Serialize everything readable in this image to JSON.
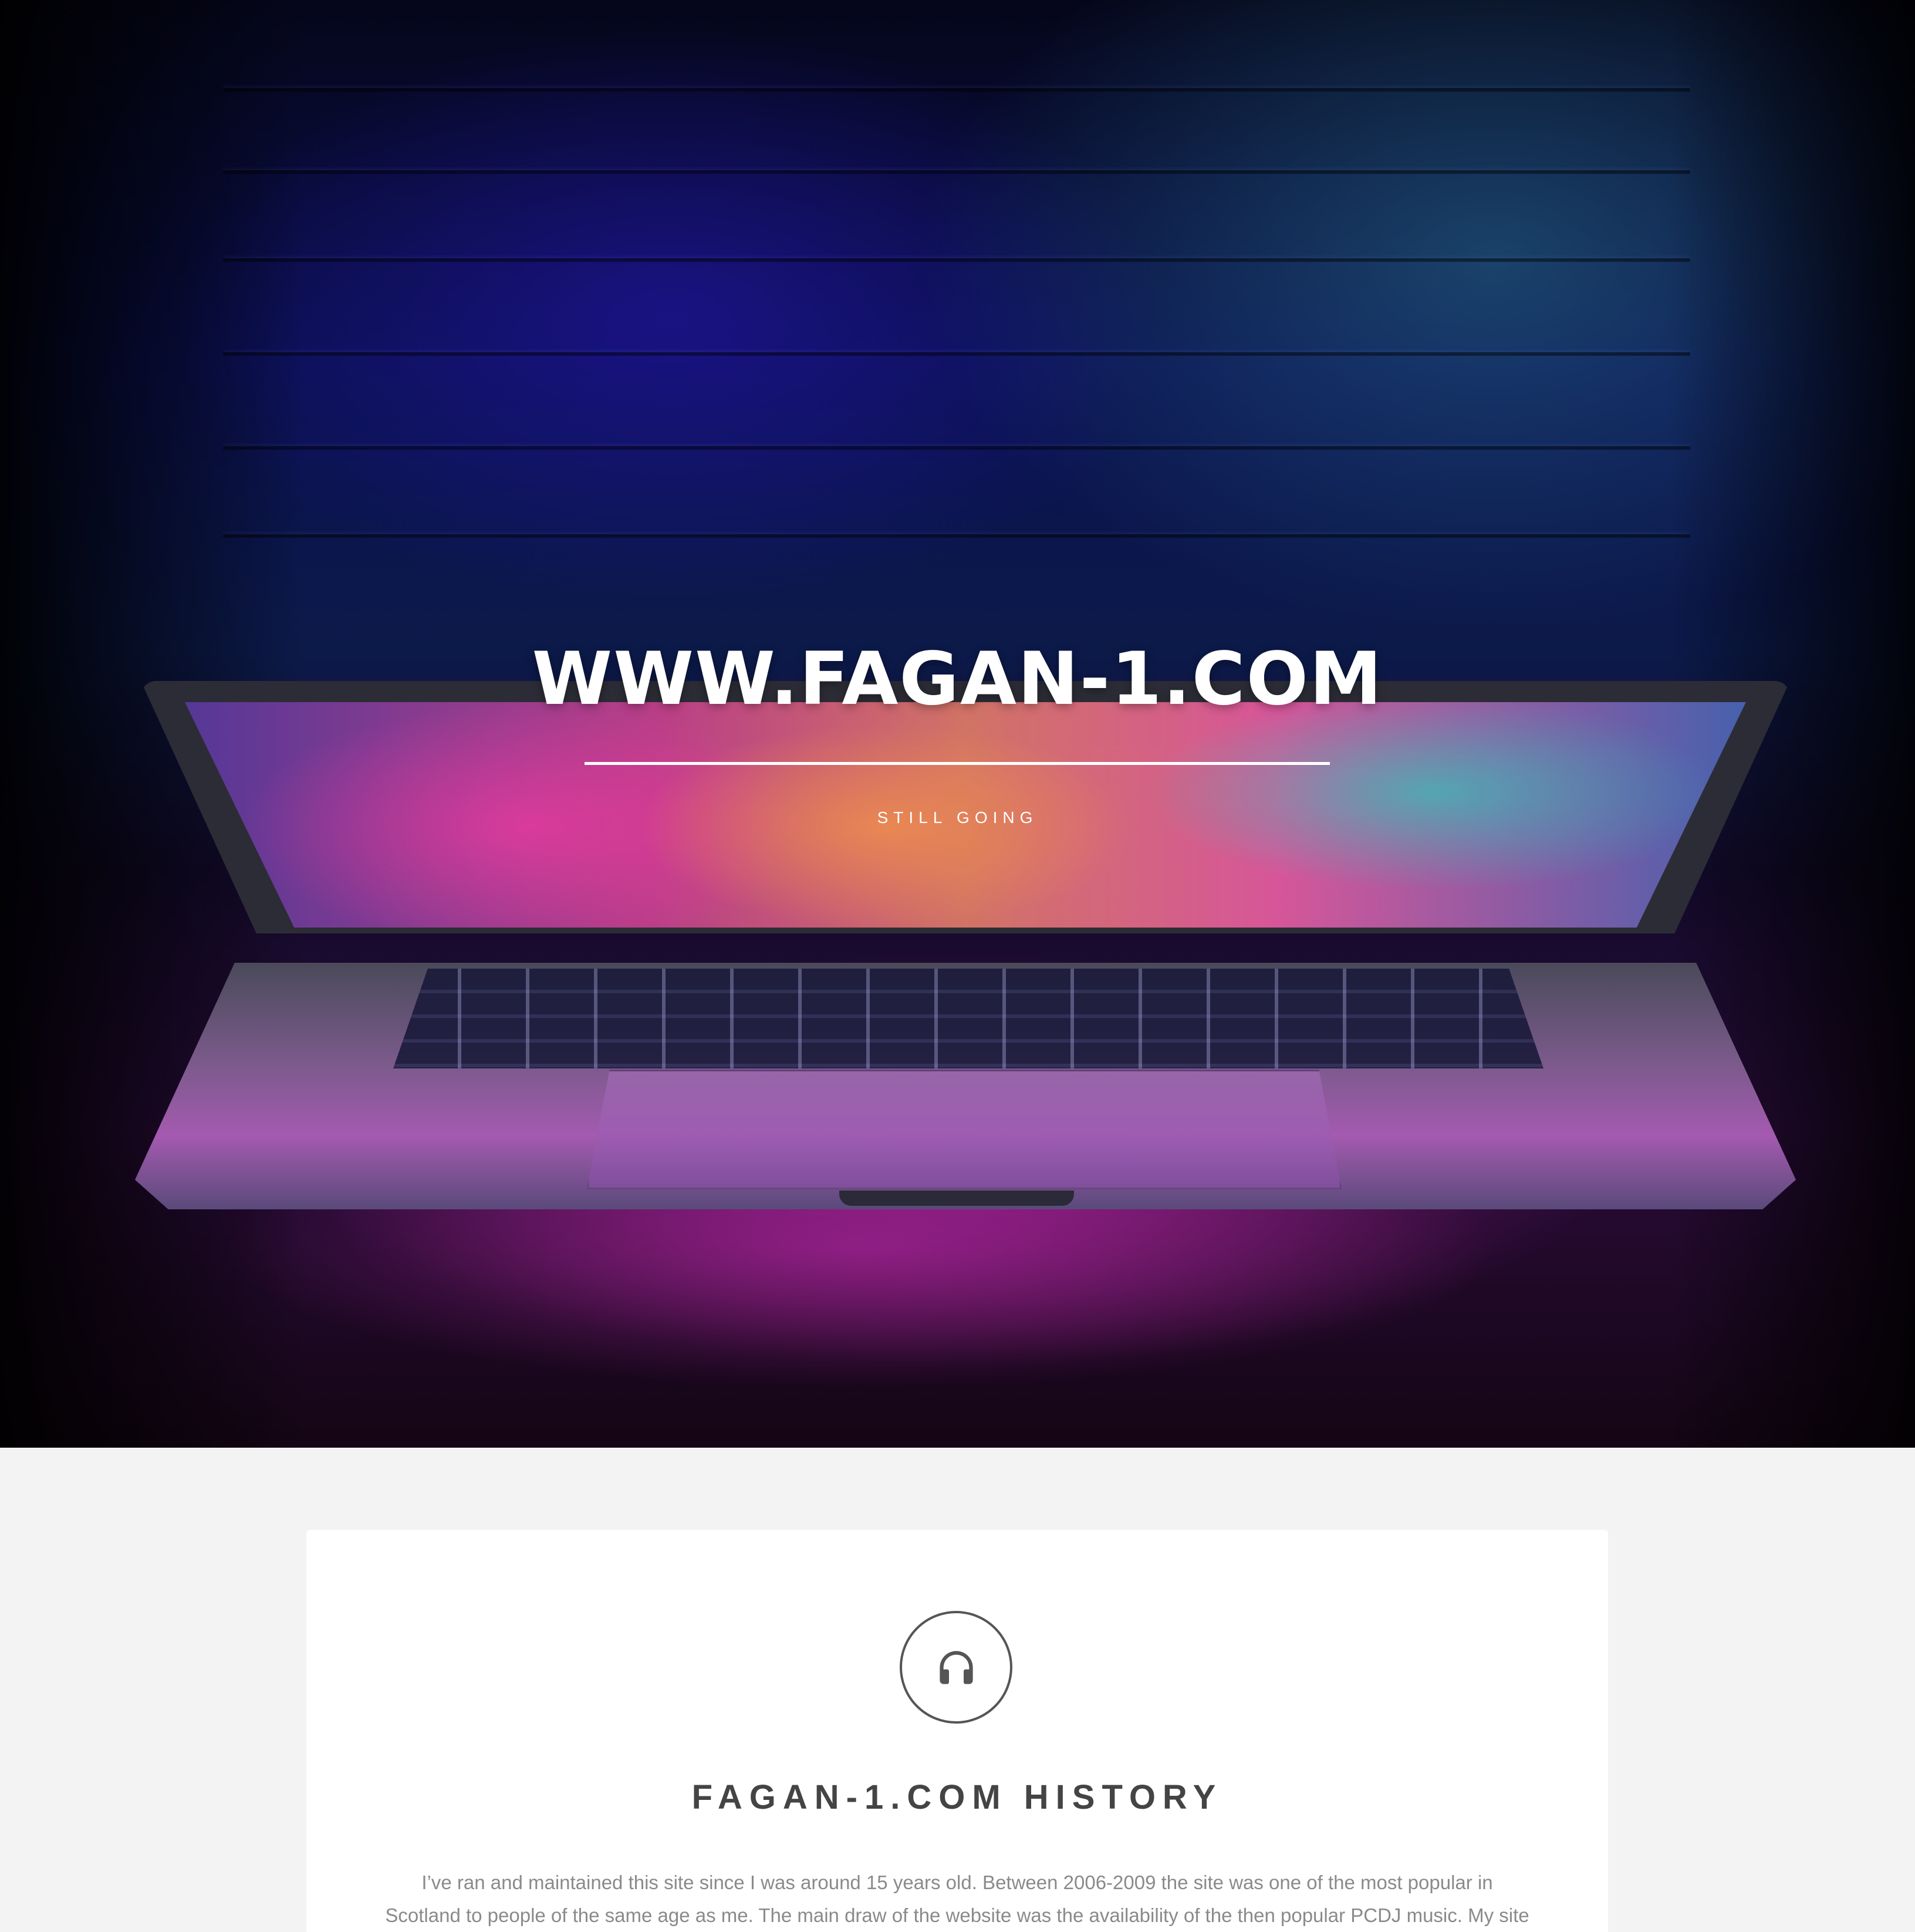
{
  "hero": {
    "title": "WWW.FAGAN-1.COM",
    "subtitle": "STILL GOING"
  },
  "section": {
    "icon": "headphones-icon",
    "title": "FAGAN-1.COM HISTORY",
    "body": "I’ve ran and maintained this site since I was around 15 years old. Between 2006-2009 the site was one of the most popular in Scotland to people of the same age as me. The main draw of the website was the availability of the then popular PCDJ music. My site was the most updated, reliable at the time hence it’s popularity. Nowadays there is no demand for the music and the website has been rarely visited for a few years. The only"
  },
  "colors": {
    "page_background": "#f3f3f3",
    "card_background": "#ffffff",
    "title_text": "#444444",
    "body_text": "#8a8a8a",
    "hero_text": "#ffffff"
  }
}
